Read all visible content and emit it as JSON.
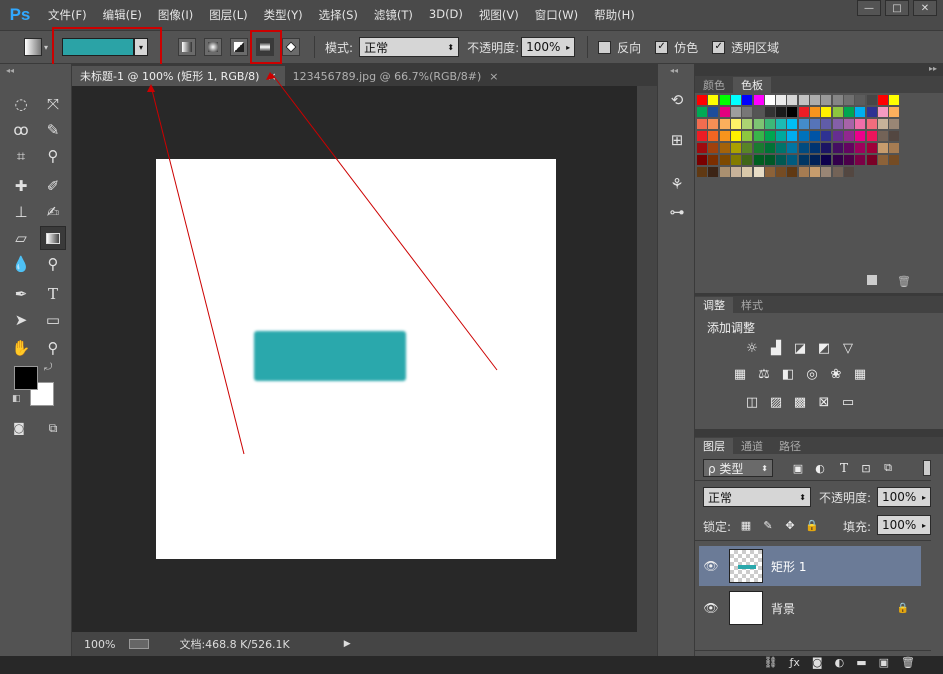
{
  "app": {
    "logo": "Ps"
  },
  "menu": [
    "文件(F)",
    "编辑(E)",
    "图像(I)",
    "图层(L)",
    "类型(Y)",
    "选择(S)",
    "滤镜(T)",
    "3D(D)",
    "视图(V)",
    "窗口(W)",
    "帮助(H)"
  ],
  "window_controls": {
    "minimize": "—",
    "restore": "□",
    "close": "✕"
  },
  "options": {
    "gradient_color": "#2ba3a6",
    "mode_label": "模式:",
    "mode_value": "正常",
    "opacity_label": "不透明度:",
    "opacity_value": "100%",
    "reverse_label": "反向",
    "reverse_checked": false,
    "dither_label": "仿色",
    "dither_checked": true,
    "transparency_label": "透明区域",
    "transparency_checked": true
  },
  "doc_tabs": [
    {
      "label": "未标题-1 @ 100% (矩形 1, RGB/8)",
      "close": "×",
      "active": true
    },
    {
      "label": "123456789.jpg @ 66.7%(RGB/8#)",
      "close": "×",
      "active": false
    }
  ],
  "canvas": {
    "rect_color": "#2aa8ac",
    "background": "#ffffff"
  },
  "status": {
    "zoom": "100%",
    "doc_info": "文档:468.8 K/526.1K",
    "arrow": "▶"
  },
  "swatches_panel": {
    "tabs": [
      "颜色",
      "色板"
    ],
    "active_tab": "色板",
    "colors": [
      [
        "#ff0000",
        "#ffff00",
        "#00ff00",
        "#00ffff",
        "#0000ff",
        "#ff00ff",
        "#ffffff",
        "#ebebeb",
        "#d6d6d6",
        "#c2c2c2",
        "#adadad",
        "#999999",
        "#858585",
        "#707070",
        "#5c5c5c",
        "#474747",
        "#ff0000",
        "#ffff00"
      ],
      [
        "#00aa55",
        "#1e4d9b",
        "#e4007f",
        "#9e9e9e",
        "#777777",
        "#555555",
        "#333333",
        "#1a1a1a",
        "#000000",
        "#ed1c24",
        "#f7941d",
        "#fff200",
        "#8dc63f",
        "#00a651",
        "#00aeef",
        "#2e3192",
        "#f49ac1",
        "#fbaf5d"
      ],
      [
        "#f26c4f",
        "#f68e55",
        "#fbaf5c",
        "#fff467",
        "#acd372",
        "#7dc473",
        "#3cb878",
        "#1cbbb4",
        "#00bff3",
        "#448ccb",
        "#5674b9",
        "#605ca8",
        "#855fa8",
        "#a763a8",
        "#f06eaa",
        "#f26d7d",
        "#c7b299",
        "#998675"
      ],
      [
        "#ed1c24",
        "#f26522",
        "#f7941d",
        "#fff200",
        "#8dc63f",
        "#39b54a",
        "#00a651",
        "#00a99d",
        "#00aeef",
        "#0072bc",
        "#0054a6",
        "#2e3192",
        "#662d91",
        "#92278f",
        "#ec008c",
        "#ed145b",
        "#736357",
        "#534741"
      ],
      [
        "#9e0b0f",
        "#a0410d",
        "#a36209",
        "#aba000",
        "#598527",
        "#1a7b30",
        "#007236",
        "#00746b",
        "#0076a3",
        "#004b80",
        "#003471",
        "#1b1464",
        "#440e62",
        "#630460",
        "#9e005d",
        "#9e0039",
        "#c69c6d",
        "#a67c52"
      ],
      [
        "#790000",
        "#7b2e00",
        "#7d4900",
        "#827b00",
        "#406618",
        "#005e20",
        "#005826",
        "#005952",
        "#005b7f",
        "#003663",
        "#002157",
        "#0d004c",
        "#32004b",
        "#4b0049",
        "#7b0046",
        "#7a0026",
        "#8c6239",
        "#754c24"
      ],
      [
        "#603913",
        "#3c2415",
        "#aa9070",
        "#c7b299",
        "#d9c8a9",
        "#e7dcc5",
        "#8c6239",
        "#754c24",
        "#603913",
        "#a67c52",
        "#c69c6d",
        "#998675",
        "#736357",
        "#534741"
      ]
    ]
  },
  "adjustments_panel": {
    "tabs": [
      "调整",
      "样式"
    ],
    "active_tab": "调整",
    "title": "添加调整"
  },
  "layers_panel": {
    "tabs": [
      "图层",
      "通道",
      "路径"
    ],
    "active_tab": "图层",
    "filter_label": "ρ 类型",
    "blend_mode": "正常",
    "opacity_label": "不透明度:",
    "opacity_value": "100%",
    "lock_label": "锁定:",
    "fill_label": "填充:",
    "fill_value": "100%",
    "layers": [
      {
        "name": "矩形 1",
        "selected": true
      },
      {
        "name": "背景",
        "selected": false
      }
    ]
  },
  "colors": {
    "annotation_red": "#cc0000",
    "fg_color": "#000000",
    "bg_color": "#ffffff"
  }
}
